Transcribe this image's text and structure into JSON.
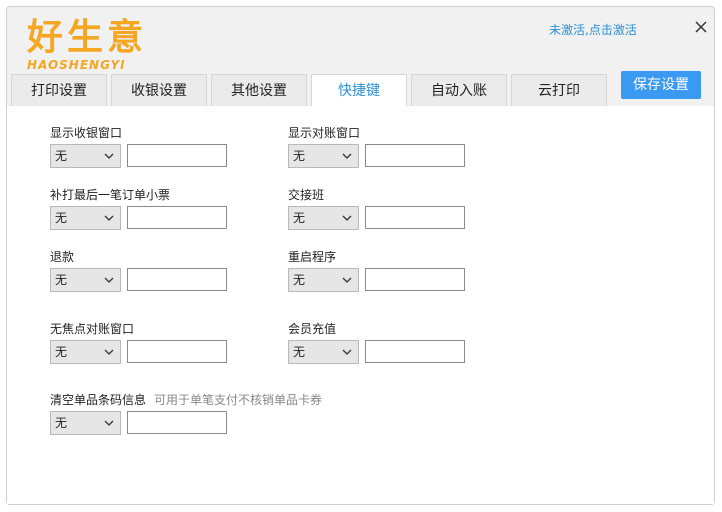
{
  "header": {
    "logo_cn": "好生意",
    "logo_en": "HAOSHENGYI",
    "activate_link": "未激活,点击激活",
    "close_icon": "close-icon"
  },
  "tabs": [
    {
      "label": "打印设置"
    },
    {
      "label": "收银设置"
    },
    {
      "label": "其他设置"
    },
    {
      "label": "快捷键",
      "active": true
    },
    {
      "label": "自动入账"
    },
    {
      "label": "云打印"
    }
  ],
  "save_button": "保存设置",
  "colors": {
    "accent": "#3a9af2",
    "logo": "#f5a623",
    "link": "#2d8fd6"
  },
  "fields": {
    "show_cashier": {
      "label": "显示收银窗口",
      "value": "无"
    },
    "show_reconcile": {
      "label": "显示对账窗口",
      "value": "无"
    },
    "reprint_last": {
      "label": "补打最后一笔订单小票",
      "value": "无"
    },
    "shift_handover": {
      "label": "交接班",
      "value": "无"
    },
    "refund": {
      "label": "退款",
      "value": "无"
    },
    "restart": {
      "label": "重启程序",
      "value": "无"
    },
    "nofocus_reconcile": {
      "label": "无焦点对账窗口",
      "value": "无"
    },
    "member_recharge": {
      "label": "会员充值",
      "value": "无"
    },
    "clear_barcode": {
      "label": "清空单品条码信息",
      "hint": "可用于单笔支付不核销单品卡券",
      "value": "无"
    }
  }
}
